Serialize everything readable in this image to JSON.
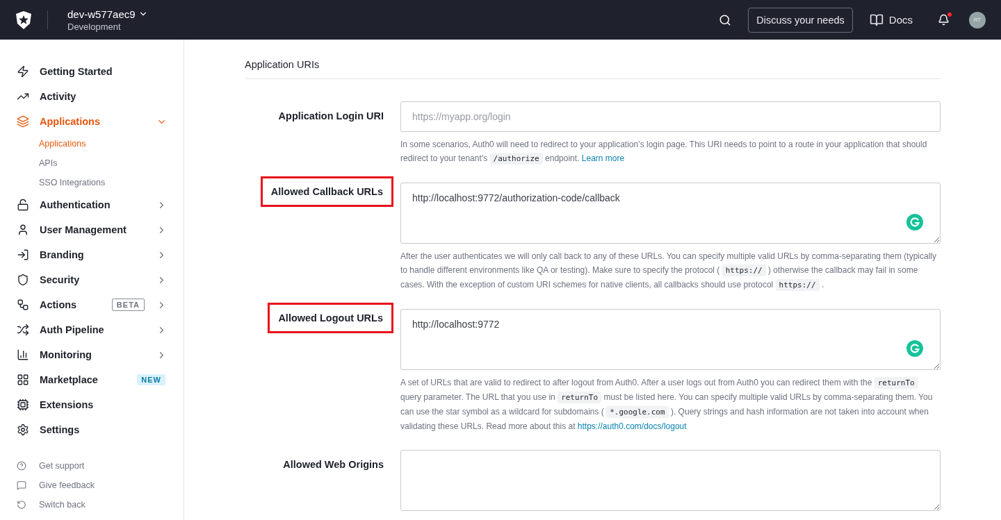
{
  "header": {
    "tenant": "dev-w577aec9",
    "environment": "Development",
    "discuss_button": "Discuss your needs",
    "docs_link": "Docs",
    "notification_unread": true,
    "avatar": "RT"
  },
  "sidebar": {
    "items": [
      {
        "label": "Getting Started",
        "selected": false
      },
      {
        "label": "Activity",
        "selected": false
      },
      {
        "label": "Applications",
        "selected": true,
        "expanded": true,
        "children": [
          {
            "label": "Applications",
            "selected": true
          },
          {
            "label": "APIs",
            "selected": false
          },
          {
            "label": "SSO Integrations",
            "selected": false
          }
        ]
      },
      {
        "label": "Authentication",
        "selected": false,
        "expanded": false
      },
      {
        "label": "User Management",
        "selected": false,
        "expanded": false
      },
      {
        "label": "Branding",
        "selected": false,
        "expanded": false
      },
      {
        "label": "Security",
        "selected": false,
        "expanded": false
      },
      {
        "label": "Actions",
        "selected": false,
        "expanded": false,
        "badge": {
          "text": "BETA",
          "kind": "outline"
        }
      },
      {
        "label": "Auth Pipeline",
        "selected": false,
        "expanded": false
      },
      {
        "label": "Monitoring",
        "selected": false,
        "expanded": false
      },
      {
        "label": "Marketplace",
        "selected": false,
        "badge": {
          "text": "NEW",
          "kind": "filled"
        }
      },
      {
        "label": "Extensions",
        "selected": false
      },
      {
        "label": "Settings",
        "selected": false
      }
    ],
    "footer": [
      {
        "label": "Get support"
      },
      {
        "label": "Give feedback"
      },
      {
        "label": "Switch back"
      }
    ]
  },
  "section": {
    "title": "Application URIs",
    "fields": [
      {
        "label": "Application Login URI",
        "highlighted": false,
        "kind": "input",
        "placeholder": "https://myapp.org/login",
        "help": [
          {
            "kind": "text",
            "text": "In some scenarios, Auth0 will need to redirect to your application’s login page. This URI needs to point to a route in your application that should redirect to your tenant’s "
          },
          {
            "kind": "code",
            "text": "/authorize"
          },
          {
            "kind": "text",
            "text": " endpoint. "
          },
          {
            "kind": "link",
            "text": "Learn more"
          }
        ]
      },
      {
        "label": "Allowed Callback URLs",
        "highlighted": true,
        "kind": "textarea",
        "grammarly": true,
        "value": "http://localhost:9772/authorization-code/callback",
        "help": [
          {
            "kind": "text",
            "text": "After the user authenticates we will only call back to any of these URLs. You can specify multiple valid URLs by comma-separating them (typically to handle different environments like QA or testing). Make sure to specify the protocol ( "
          },
          {
            "kind": "code",
            "text": "https://"
          },
          {
            "kind": "text",
            "text": " ) otherwise the callback may fail in some cases. With the exception of custom URI schemes for native clients, all callbacks should use protocol "
          },
          {
            "kind": "code",
            "text": "https://"
          },
          {
            "kind": "text",
            "text": " ."
          }
        ]
      },
      {
        "label": "Allowed Logout URLs",
        "highlighted": true,
        "kind": "textarea",
        "grammarly": true,
        "value": "http://localhost:9772",
        "help": [
          {
            "kind": "text",
            "text": "A set of URLs that are valid to redirect to after logout from Auth0. After a user logs out from Auth0 you can redirect them with the "
          },
          {
            "kind": "code",
            "text": "returnTo"
          },
          {
            "kind": "text",
            "text": " query parameter. The URL that you use in "
          },
          {
            "kind": "code",
            "text": "returnTo"
          },
          {
            "kind": "text",
            "text": " must be listed here. You can specify multiple valid URLs by comma-separating them. You can use the star symbol as a wildcard for subdomains ( "
          },
          {
            "kind": "code",
            "text": "*.google.com"
          },
          {
            "kind": "text",
            "text": " ). Query strings and hash information are not taken into account when validating these URLs. Read more about this at "
          },
          {
            "kind": "link",
            "text": "https://auth0.com/docs/logout"
          }
        ]
      },
      {
        "label": "Allowed Web Origins",
        "highlighted": false,
        "kind": "textarea"
      }
    ]
  }
}
